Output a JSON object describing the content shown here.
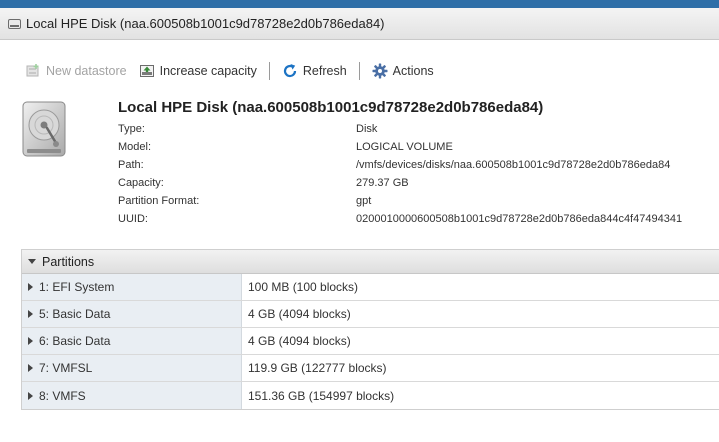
{
  "window": {
    "title": "Local HPE Disk (naa.600508b1001c9d78728e2d0b786eda84)",
    "title_icon": "disk-icon"
  },
  "toolbar": {
    "items": [
      {
        "label": "New datastore",
        "icon": "new-datastore-icon",
        "enabled": false
      },
      {
        "label": "Increase capacity",
        "icon": "increase-capacity-icon",
        "enabled": true
      },
      {
        "label": "Refresh",
        "icon": "refresh-icon",
        "enabled": true
      },
      {
        "label": "Actions",
        "icon": "gear-icon",
        "enabled": true
      }
    ]
  },
  "disk": {
    "title": "Local HPE Disk (naa.600508b1001c9d78728e2d0b786eda84)",
    "properties": [
      {
        "label": "Type:",
        "value": "Disk"
      },
      {
        "label": "Model:",
        "value": "LOGICAL VOLUME"
      },
      {
        "label": "Path:",
        "value": "/vmfs/devices/disks/naa.600508b1001c9d78728e2d0b786eda84"
      },
      {
        "label": "Capacity:",
        "value": "279.37 GB"
      },
      {
        "label": "Partition Format:",
        "value": "gpt"
      },
      {
        "label": "UUID:",
        "value": "0200010000600508b1001c9d78728e2d0b786eda844c4f47494341"
      }
    ]
  },
  "partitions": {
    "header": "Partitions",
    "rows": [
      {
        "name": "1: EFI System",
        "size": "100 MB (100 blocks)"
      },
      {
        "name": "5: Basic Data",
        "size": "4 GB (4094 blocks)"
      },
      {
        "name": "6: Basic Data",
        "size": "4 GB (4094 blocks)"
      },
      {
        "name": "7: VMFSL",
        "size": "119.9 GB (122777 blocks)"
      },
      {
        "name": "8: VMFS",
        "size": "151.36 GB (154997 blocks)"
      }
    ]
  },
  "colors": {
    "accent": "#2f6fa8",
    "refresh_blue": "#1c73c4",
    "gear_blue": "#4a6fa5",
    "increase_green": "#3a8a3a",
    "row_label_bg": "#e9eef3"
  }
}
